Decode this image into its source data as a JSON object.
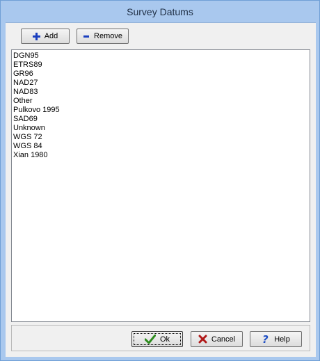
{
  "window": {
    "title": "Survey Datums"
  },
  "toolbar": {
    "add_label": "Add",
    "remove_label": "Remove",
    "add_icon": "plus-icon",
    "remove_icon": "minus-icon"
  },
  "datums": {
    "items": [
      "DGN95",
      "ETRS89",
      "GR96",
      "NAD27",
      "NAD83",
      "Other",
      "Pulkovo 1995",
      "SAD69",
      "Unknown",
      "WGS 72",
      "WGS 84",
      "Xian 1980"
    ]
  },
  "footer": {
    "ok_label": "Ok",
    "cancel_label": "Cancel",
    "help_label": "Help",
    "ok_icon": "checkmark-icon",
    "cancel_icon": "red-x-icon",
    "help_icon": "question-mark-icon"
  },
  "colors": {
    "titlebar": "#a9c8ee",
    "add_icon": "#1b3fbf",
    "ok_icon": "#2e8b1e",
    "cancel_icon": "#b01818",
    "help_icon": "#1f4fc4"
  }
}
